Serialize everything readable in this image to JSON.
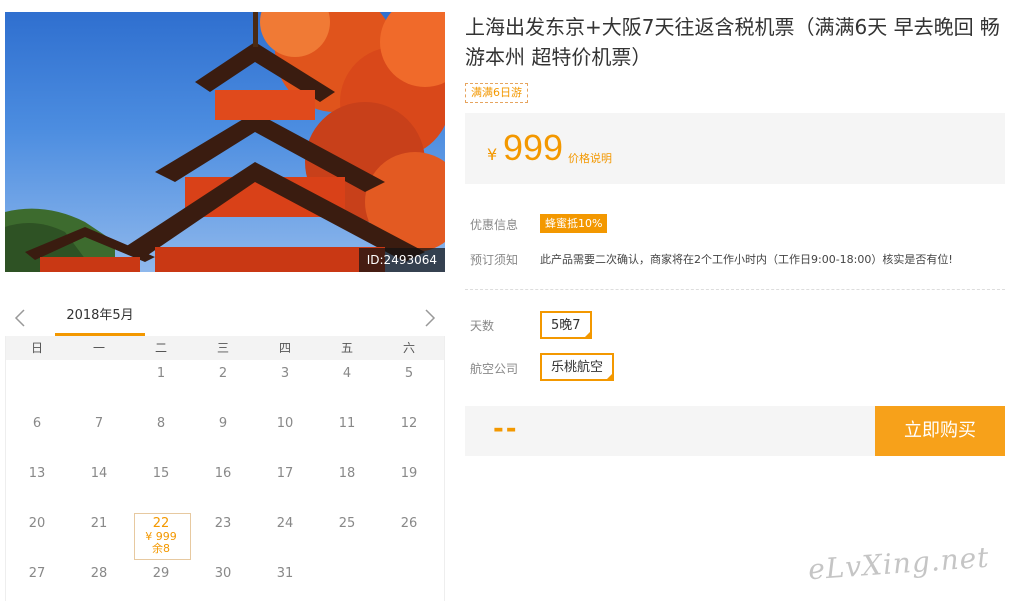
{
  "photo": {
    "id_label": "ID:2493064"
  },
  "product": {
    "title": "上海出发东京+大阪7天往返含税机票（满满6天 早去晚回 畅游本州 超特价机票）",
    "tag": "满满6日游",
    "currency": "¥",
    "price": "999",
    "price_explain": "价格说明"
  },
  "info": {
    "promo_label": "优惠信息",
    "promo_badge": "蜂蜜抵10%",
    "notice_label": "预订须知",
    "notice_text": "此产品需要二次确认，商家将在2个工作小时内（工作日9:00-18:00）核实是否有位!"
  },
  "options": {
    "days_label": "天数",
    "days_value": "5晚7",
    "airline_label": "航空公司",
    "airline_value": "乐桃航空"
  },
  "purchase": {
    "total": "--",
    "buy_label": "立即购买"
  },
  "calendar": {
    "month": "2018年5月",
    "weekdays": [
      "日",
      "一",
      "二",
      "三",
      "四",
      "五",
      "六"
    ],
    "rows": [
      [
        "",
        "",
        "1",
        "2",
        "3",
        "4",
        "5"
      ],
      [
        "6",
        "7",
        "8",
        "9",
        "10",
        "11",
        "12"
      ],
      [
        "13",
        "14",
        "15",
        "16",
        "17",
        "18",
        "19"
      ],
      [
        "20",
        "21",
        "22",
        "23",
        "24",
        "25",
        "26"
      ],
      [
        "27",
        "28",
        "29",
        "30",
        "31",
        "",
        ""
      ]
    ],
    "special": {
      "day": "22",
      "price": "¥ 999",
      "stock": "余8"
    }
  },
  "watermark": "eLvXing.net",
  "colors": {
    "accent": "#f39800",
    "panel_bg": "#f5f5f5",
    "buy_button": "#f7a11a"
  },
  "icons": {
    "prev": "chevron-left-icon",
    "next": "chevron-right-icon"
  }
}
